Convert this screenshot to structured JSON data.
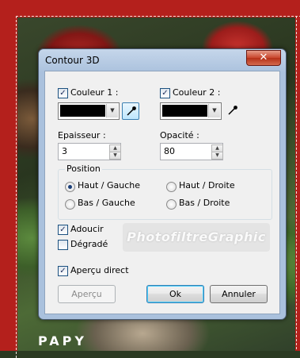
{
  "window": {
    "title": "Contour 3D",
    "close_label": "✕"
  },
  "color1": {
    "checked": true,
    "label": "Couleur 1 :",
    "value": "#000000"
  },
  "color2": {
    "checked": true,
    "label": "Couleur 2 :",
    "value": "#000000"
  },
  "thickness": {
    "label": "Epaisseur :",
    "value": "3"
  },
  "opacity": {
    "label": "Opacité :",
    "value": "80"
  },
  "position": {
    "title": "Position",
    "options": [
      {
        "label": "Haut / Gauche",
        "selected": true
      },
      {
        "label": "Haut / Droite",
        "selected": false
      },
      {
        "label": "Bas / Gauche",
        "selected": false
      },
      {
        "label": "Bas / Droite",
        "selected": false
      }
    ]
  },
  "smooth": {
    "label": "Adoucir",
    "checked": true
  },
  "gradient": {
    "label": "Dégradé",
    "checked": false
  },
  "preview": {
    "label": "Aperçu direct",
    "checked": true
  },
  "watermark": "PhotofiltreGraphic",
  "buttons": {
    "preview": "Aperçu",
    "ok": "Ok",
    "cancel": "Annuler"
  },
  "background": {
    "signature": "PAPY",
    "frame_color": "#b4201c"
  },
  "colors": {
    "accent": "#3c7fb1",
    "checkmark": "#22315f",
    "close_red": "#c8452c"
  }
}
